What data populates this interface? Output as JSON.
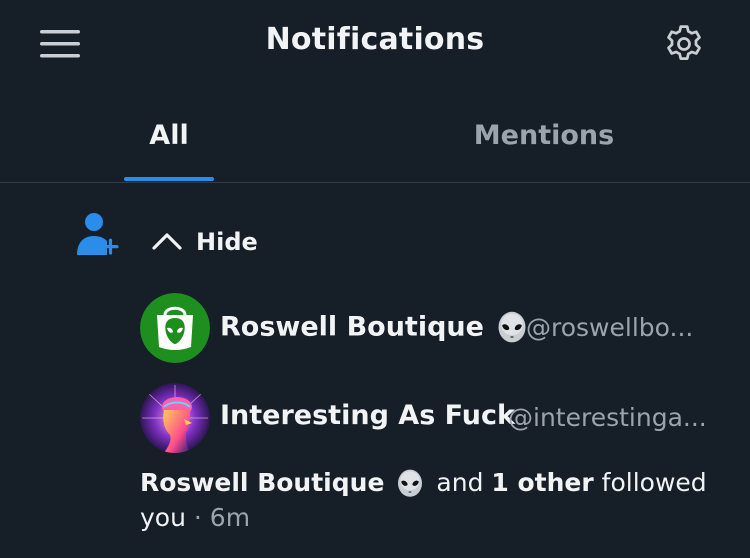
{
  "header": {
    "title": "Notifications",
    "menu_icon": "hamburger-menu-icon",
    "settings_icon": "gear-icon"
  },
  "tabs": [
    {
      "label": "All",
      "active": true
    },
    {
      "label": "Mentions",
      "active": false
    }
  ],
  "notification": {
    "type_icon": "follow-person-plus-icon",
    "toggle_label": "Hide",
    "toggle_icon": "chevron-up-icon",
    "followers": [
      {
        "name": "Roswell Boutique",
        "handle": "@roswellbo...",
        "name_emoji": "alien-emoji",
        "avatar": "green-shopping-bag-alien-logo"
      },
      {
        "name": "Interesting As Fuck",
        "handle": "@interestinga...",
        "avatar": "neon-brain-head-art"
      }
    ],
    "summary": {
      "actor": "Roswell Boutique",
      "actor_emoji": "alien-emoji",
      "connector": "and",
      "others": "1 other",
      "action": "followed",
      "object": "you",
      "separator": "·",
      "time": "6m"
    }
  },
  "colors": {
    "background": "#161e27",
    "accent": "#2a8dea",
    "text_primary": "#f1f3f5",
    "text_secondary": "#9ba3ad",
    "divider": "#2e3a46",
    "boutique_green": "#1e8e1e"
  }
}
